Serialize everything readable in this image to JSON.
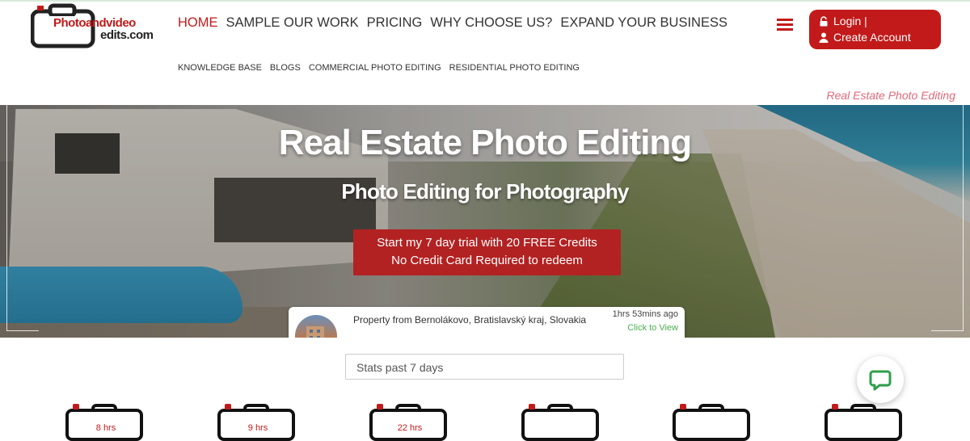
{
  "logo": {
    "part1": "Photoandvideo",
    "part2": "edits.com"
  },
  "nav": {
    "main": [
      "HOME",
      "SAMPLE OUR WORK",
      "PRICING",
      "WHY CHOOSE US?",
      "EXPAND YOUR BUSINESS"
    ],
    "sub": [
      "KNOWLEDGE BASE",
      "BLOGS",
      "COMMERCIAL PHOTO EDITING",
      "RESIDENTIAL PHOTO EDITING"
    ]
  },
  "auth": {
    "login": "Login  |",
    "create": "Create Account"
  },
  "page_tag": "Real Estate Photo Editing",
  "hero": {
    "title": "Real Estate Photo Editing",
    "subtitle": "Photo Editing for Photography",
    "cta_line1": "Start my 7 day trial with 20 FREE Credits",
    "cta_line2": "No Credit Card Required to redeem"
  },
  "activity": {
    "title": "Property from Bernolákovo, Bratislavský kraj, Slovakia",
    "ago": "1hrs 53mins ago",
    "view": "Click to View"
  },
  "stats": {
    "select": "Stats past 7 days",
    "items": [
      "8 hrs",
      "9 hrs",
      "22 hrs",
      "",
      "",
      ""
    ]
  },
  "colors": {
    "brand_red": "#c21a1a",
    "cta_red": "#b22222",
    "link_green": "#4caf50"
  }
}
